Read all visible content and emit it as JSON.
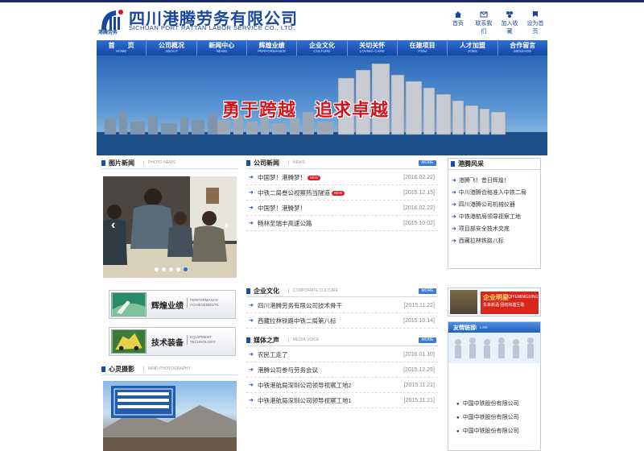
{
  "header": {
    "logo_name": "四川港腾劳务有限公司",
    "logo_en": "SICHUAN PORT RATTAN LABOR SERVICE CO., LTD.",
    "logo_sub": "港腾劳务",
    "links": [
      {
        "label": "首页",
        "icon": "home-icon"
      },
      {
        "label": "联系我们",
        "icon": "mail-icon"
      },
      {
        "label": "加入收藏",
        "icon": "bookmark-icon"
      },
      {
        "label": "设为首页",
        "icon": "homepage-icon"
      }
    ]
  },
  "nav": [
    {
      "cn": "首　　页",
      "en": "HOME"
    },
    {
      "cn": "公司概况",
      "en": "ABOUT"
    },
    {
      "cn": "新闻中心",
      "en": "NEWS"
    },
    {
      "cn": "辉煌业绩",
      "en": "PERFORMANCE"
    },
    {
      "cn": "企业文化",
      "en": "CULTURE"
    },
    {
      "cn": "关切关怀",
      "en": "LOVING CARE"
    },
    {
      "cn": "在建项目",
      "en": "ITEM"
    },
    {
      "cn": "人才加盟",
      "en": "JOBS"
    },
    {
      "cn": "合作留言",
      "en": "MESSAGE"
    }
  ],
  "banner": {
    "slogan": "勇于跨越　追求卓越"
  },
  "photo_news": {
    "title": "图片新闻",
    "en": "PHOTO NEWS",
    "dots": 5,
    "active_dot": 4
  },
  "company_news": {
    "title": "公司新闻",
    "en": "NEWS",
    "more": "MORE",
    "items": [
      {
        "text": "中国梦！港腾梦！",
        "date": "[2016.02.22]",
        "hot": true
      },
      {
        "text": "中铁二局叁公视察热当隧道",
        "date": "[2015.12.15]",
        "hot": true
      },
      {
        "text": "中国梦！港腾梦！",
        "date": "[2016.02.22]",
        "hot": false
      },
      {
        "text": "畅林至瑞丰高速公路",
        "date": "[2015.10.02]",
        "hot": false
      }
    ],
    "hot_label": "NEW"
  },
  "side_news": {
    "title": "港腾风采",
    "items": [
      "港腾飞！昔日辉煌！",
      "中川港腾合格准入中铁二局",
      "四川港腾公司机械仪器",
      "中铁港航局领导视察工地",
      "项目部安全技术交底",
      "西藏拉林铁路八标"
    ]
  },
  "features": [
    {
      "cn": "辉煌业绩",
      "en1": "PERFORMANCE",
      "en2": "ACHIEVEMENTS"
    },
    {
      "cn": "技术装备",
      "en1": "EQUIPMENT",
      "en2": "TECHNOLOGY"
    }
  ],
  "culture": {
    "title": "企业文化",
    "en": "CORPORATE CULTURE",
    "more": "MORE",
    "items": [
      {
        "text": "四川港腾劳务有限公司技术骨干",
        "date": "[2015.11.22]"
      },
      {
        "text": "西藏拉林铁路中铁二局第八标",
        "date": "[2015.10.14]"
      }
    ]
  },
  "media": {
    "title": "媒体之声",
    "en": "MEDIA VOICE",
    "more": "MORE",
    "items": [
      {
        "text": "农民工走了",
        "date": "[2016.01.10]"
      },
      {
        "text": "港腾公司参与劳务会议",
        "date": "[2015.12.25]"
      },
      {
        "text": "中铁港航局深圳公司领导视察工地2",
        "date": "[2015.11.21]"
      },
      {
        "text": "中铁港航局深圳公司领导视察工地1",
        "date": "[2015.11.21]"
      }
    ]
  },
  "mind_photo": {
    "title": "心灵摄影",
    "en": "MIND PHOTOGRAPHY"
  },
  "qiye": {
    "cn": "企业明星",
    "en": "QIYEMINGXING",
    "sub1": "东来新酒",
    "sub2": "团结和谐互助"
  },
  "friend_links": {
    "title": "友情链接",
    "en": "LINK",
    "items": [
      "中国中铁股份有限公司",
      "中国中铁股份有限公司",
      "中国中铁股份有限公司"
    ]
  },
  "colors": {
    "brand": "#17479e",
    "nav": "#1247a6",
    "hot": "#e21a22",
    "slogan": "#d1161e"
  }
}
